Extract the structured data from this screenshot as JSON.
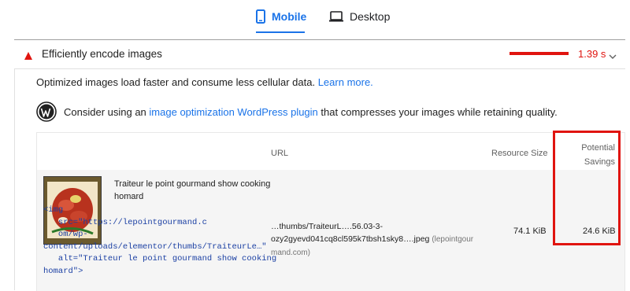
{
  "tabs": [
    {
      "label": "Mobile",
      "icon": "mobile-phone-icon",
      "active": true
    },
    {
      "label": "Desktop",
      "icon": "desktop-monitor-icon",
      "active": false
    }
  ],
  "audit": {
    "status_icon": "warning-triangle-icon",
    "title": "Efficiently encode images",
    "savings_time": "1.39 s",
    "expand_icon": "chevron-down-icon",
    "description": "Optimized images load faster and consume less cellular data.",
    "learn_more": "Learn more.",
    "wp_icon": "wordpress-logo-icon",
    "wp_text_before": "Consider using an",
    "wp_link": "image optimization WordPress plugin",
    "wp_text_after": "that compresses your images while retaining quality."
  },
  "table": {
    "headers": {
      "url": "URL",
      "resource_size": "Resource Size",
      "potential_savings_line1": "Potential",
      "potential_savings_line2": "Savings"
    },
    "rows": [
      {
        "caption": "Traiteur le point gourmand show cooking homard",
        "snippet": "<img\n   src=\"https://lepointgourmand.c\n   om/wp-\ncontent/uploads/elementor/thumbs/TraiteurLe…\"\n   alt=\"Traiteur le point gourmand show cooking\nhomard\">",
        "url_line1": "…thumbs/TraiteurL….56.03-3-",
        "url_line2": "ozy2gyevd041cq8cl595k7tbsh1sky8….jpeg",
        "host": "(lepointgour mand.com)",
        "resource_size": "74.1 KiB",
        "potential_savings": "24.6 KiB"
      }
    ]
  },
  "colors": {
    "accent": "#1a73e8",
    "fail": "#e0140f"
  }
}
